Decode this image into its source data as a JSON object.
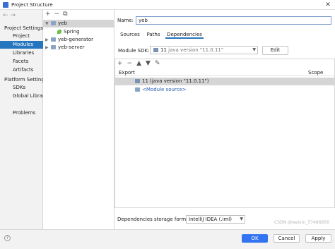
{
  "window": {
    "title": "Project Structure",
    "close": "✕"
  },
  "nav": {
    "back": "←",
    "forward": "→"
  },
  "left_panel": {
    "project_settings_header": "Project Settings",
    "project_settings_items": [
      "Project",
      "Modules",
      "Libraries",
      "Facets",
      "Artifacts"
    ],
    "platform_settings_header": "Platform Settings",
    "platform_settings_items": [
      "SDKs",
      "Global Librari"
    ],
    "problems": "Problems"
  },
  "tree": {
    "toolbar": [
      "+",
      "−",
      "⧉"
    ],
    "items": [
      {
        "label": "yeb",
        "expanded": true,
        "selected": true
      },
      {
        "label": "Spring"
      },
      {
        "label": "yeb-generator"
      },
      {
        "label": "yeb-server"
      }
    ]
  },
  "module": {
    "name_label": "Name:",
    "name_value": "yeb",
    "tabs": [
      "Sources",
      "Paths",
      "Dependencies"
    ],
    "active_tab": "Dependencies",
    "sdk_label": "Module SDK:",
    "sdk_value_main": "11",
    "sdk_value_detail": "java version \"11.0.11\"",
    "edit_button": "Edit",
    "dep_toolbar": [
      "+",
      "−",
      "▲",
      "▼",
      "✎"
    ],
    "columns": {
      "export": "Export",
      "scope": "Scope"
    },
    "dependencies": [
      {
        "label": "11 (java version \"11.0.11\")",
        "selected": true
      },
      {
        "label": "<Module source>"
      }
    ],
    "storage_label": "Dependencies storage format:",
    "storage_value": "IntelliJ IDEA (.iml)"
  },
  "footer": {
    "help": "?",
    "ok": "OK",
    "cancel": "Cancel",
    "apply": "Apply"
  },
  "watermark": "CSDN @weixin_57486856"
}
